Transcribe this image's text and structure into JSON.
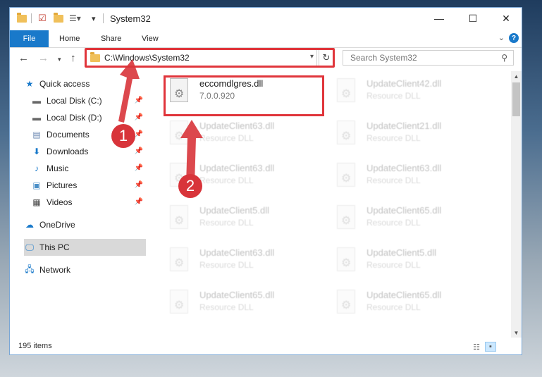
{
  "window": {
    "title": "System32",
    "controls": {
      "minimize": "—",
      "maximize": "☐",
      "close": "✕"
    }
  },
  "ribbon": {
    "tabs": [
      "File",
      "Home",
      "Share",
      "View"
    ],
    "expand_icon": "chevron-down-icon",
    "help_label": "?"
  },
  "navigation": {
    "address_path": "C:\\Windows\\System32",
    "search_placeholder": "Search System32"
  },
  "sidebar": {
    "items": [
      {
        "label": "Quick access",
        "icon": "star-icon",
        "pinned": false
      },
      {
        "label": "Local Disk (C:)",
        "icon": "drive-icon",
        "pinned": true
      },
      {
        "label": "Local Disk (D:)",
        "icon": "drive-icon",
        "pinned": true
      },
      {
        "label": "Documents",
        "icon": "documents-icon",
        "pinned": true
      },
      {
        "label": "Downloads",
        "icon": "download-icon",
        "pinned": true
      },
      {
        "label": "Music",
        "icon": "music-icon",
        "pinned": true
      },
      {
        "label": "Pictures",
        "icon": "pictures-icon",
        "pinned": true
      },
      {
        "label": "Videos",
        "icon": "videos-icon",
        "pinned": true
      },
      {
        "label": "OneDrive",
        "icon": "cloud-icon",
        "pinned": false
      },
      {
        "label": "This PC",
        "icon": "computer-icon",
        "pinned": false,
        "selected": true
      },
      {
        "label": "Network",
        "icon": "network-icon",
        "pinned": false
      }
    ]
  },
  "files": [
    {
      "name": "eccomdlgres.dll",
      "detail": "7.0.0.920",
      "highlighted": true
    },
    {
      "name": "UpdateClient42.dll",
      "detail": "Resource DLL"
    },
    {
      "name": "UpdateClient63.dll",
      "detail": "Resource DLL"
    },
    {
      "name": "UpdateClient21.dll",
      "detail": "Resource DLL"
    },
    {
      "name": "UpdateClient63.dll",
      "detail": "Resource DLL"
    },
    {
      "name": "UpdateClient63.dll",
      "detail": "Resource DLL"
    },
    {
      "name": "UpdateClient5.dll",
      "detail": "Resource DLL"
    },
    {
      "name": "UpdateClient65.dll",
      "detail": "Resource DLL"
    },
    {
      "name": "UpdateClient63.dll",
      "detail": "Resource DLL"
    },
    {
      "name": "UpdateClient5.dll",
      "detail": "Resource DLL"
    },
    {
      "name": "UpdateClient65.dll",
      "detail": "Resource DLL"
    },
    {
      "name": "UpdateClient65.dll",
      "detail": "Resource DLL"
    }
  ],
  "status": {
    "item_count": "195 items"
  },
  "annotations": {
    "step1": "1",
    "step2": "2",
    "color": "#d8343a"
  }
}
